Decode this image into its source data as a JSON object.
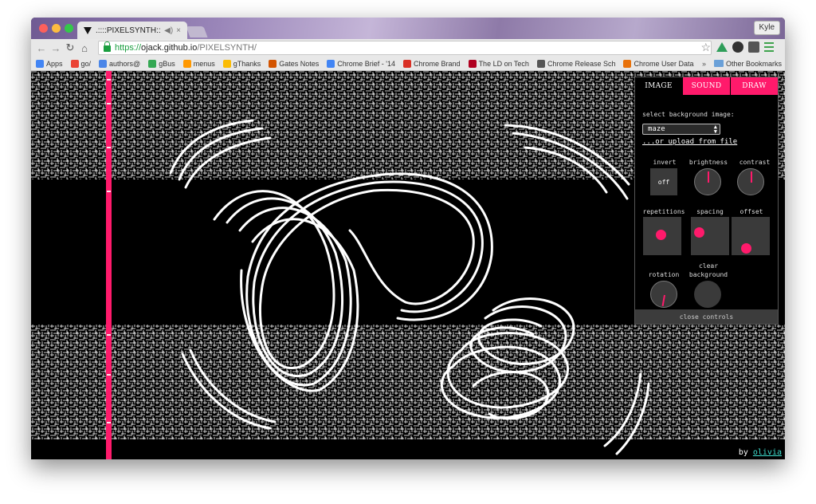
{
  "browser": {
    "tab_title": ".::::PIXELSYNTH::::.",
    "profile": "Kyle",
    "url": {
      "scheme": "https://",
      "host": "ojack.github.io",
      "path": "/PIXELSYNTH/"
    },
    "bookmarks": [
      {
        "label": "Apps",
        "color": "#4285f4"
      },
      {
        "label": "go/",
        "color": "#ea4335"
      },
      {
        "label": "authors@",
        "color": "#4a86e8"
      },
      {
        "label": "gBus",
        "color": "#34a853"
      },
      {
        "label": "menus",
        "color": "#ff9800"
      },
      {
        "label": "gThanks",
        "color": "#fbbc05"
      },
      {
        "label": "Gates Notes",
        "color": "#d35400"
      },
      {
        "label": "Chrome Brief - '14",
        "color": "#4285f4"
      },
      {
        "label": "Chrome Brand",
        "color": "#d93025"
      },
      {
        "label": "The LD on Tech",
        "color": "#b00020"
      },
      {
        "label": "Chrome Release Sch",
        "color": "#555555"
      },
      {
        "label": "Chrome User Data",
        "color": "#e8710a"
      }
    ],
    "bookmarks_overflow": "»",
    "other_bookmarks": "Other Bookmarks"
  },
  "panel": {
    "tabs": [
      {
        "label": "IMAGE",
        "active": true
      },
      {
        "label": "SOUND",
        "active": false
      },
      {
        "label": "DRAW",
        "active": false
      }
    ],
    "select_label": "select background image:",
    "select_value": "maze",
    "upload_label": "...or upload from file",
    "invert_label": "invert",
    "invert_value": "off",
    "brightness_label": "brightness",
    "contrast_label": "contrast",
    "repetitions_label": "repetitions",
    "spacing_label": "spacing",
    "offset_label": "offset",
    "rotation_label": "rotation",
    "clear_label_line1": "clear",
    "clear_label_line2": "background",
    "close_label": "close controls",
    "colors": {
      "accent": "#ff1a6b",
      "control_bg": "#3a3a3a"
    }
  },
  "credit": {
    "prefix": "by ",
    "link": "olivia",
    "link_color": "#3fe0d0"
  }
}
